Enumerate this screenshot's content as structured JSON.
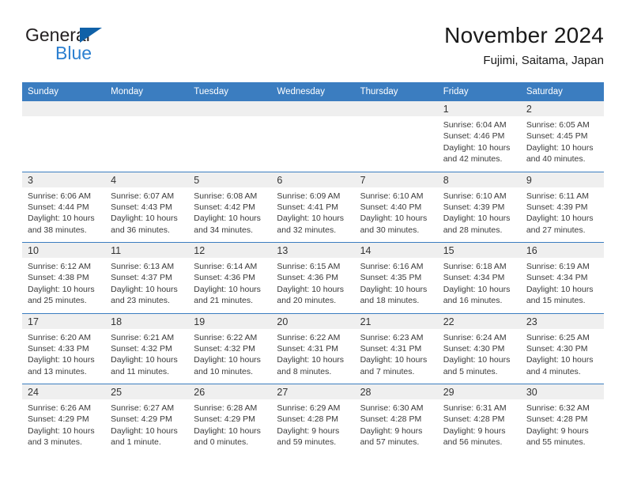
{
  "brand": {
    "word1": "General",
    "word2": "Blue",
    "triangle_color": "#1061a8",
    "word2_color": "#2b7fd0"
  },
  "header": {
    "title": "November 2024",
    "subtitle": "Fujimi, Saitama, Japan"
  },
  "theme": {
    "header_blue": "#3b7dc0",
    "daynum_band": "#efefef",
    "page_bg": "#ffffff"
  },
  "weekdays": [
    "Sunday",
    "Monday",
    "Tuesday",
    "Wednesday",
    "Thursday",
    "Friday",
    "Saturday"
  ],
  "weeks": [
    [
      {
        "day": "",
        "empty": true,
        "sunrise": "",
        "sunset": "",
        "daylight1": "",
        "daylight2": ""
      },
      {
        "day": "",
        "empty": true,
        "sunrise": "",
        "sunset": "",
        "daylight1": "",
        "daylight2": ""
      },
      {
        "day": "",
        "empty": true,
        "sunrise": "",
        "sunset": "",
        "daylight1": "",
        "daylight2": ""
      },
      {
        "day": "",
        "empty": true,
        "sunrise": "",
        "sunset": "",
        "daylight1": "",
        "daylight2": ""
      },
      {
        "day": "",
        "empty": true,
        "sunrise": "",
        "sunset": "",
        "daylight1": "",
        "daylight2": ""
      },
      {
        "day": "1",
        "empty": false,
        "sunrise": "Sunrise: 6:04 AM",
        "sunset": "Sunset: 4:46 PM",
        "daylight1": "Daylight: 10 hours",
        "daylight2": "and 42 minutes."
      },
      {
        "day": "2",
        "empty": false,
        "sunrise": "Sunrise: 6:05 AM",
        "sunset": "Sunset: 4:45 PM",
        "daylight1": "Daylight: 10 hours",
        "daylight2": "and 40 minutes."
      }
    ],
    [
      {
        "day": "3",
        "empty": false,
        "sunrise": "Sunrise: 6:06 AM",
        "sunset": "Sunset: 4:44 PM",
        "daylight1": "Daylight: 10 hours",
        "daylight2": "and 38 minutes."
      },
      {
        "day": "4",
        "empty": false,
        "sunrise": "Sunrise: 6:07 AM",
        "sunset": "Sunset: 4:43 PM",
        "daylight1": "Daylight: 10 hours",
        "daylight2": "and 36 minutes."
      },
      {
        "day": "5",
        "empty": false,
        "sunrise": "Sunrise: 6:08 AM",
        "sunset": "Sunset: 4:42 PM",
        "daylight1": "Daylight: 10 hours",
        "daylight2": "and 34 minutes."
      },
      {
        "day": "6",
        "empty": false,
        "sunrise": "Sunrise: 6:09 AM",
        "sunset": "Sunset: 4:41 PM",
        "daylight1": "Daylight: 10 hours",
        "daylight2": "and 32 minutes."
      },
      {
        "day": "7",
        "empty": false,
        "sunrise": "Sunrise: 6:10 AM",
        "sunset": "Sunset: 4:40 PM",
        "daylight1": "Daylight: 10 hours",
        "daylight2": "and 30 minutes."
      },
      {
        "day": "8",
        "empty": false,
        "sunrise": "Sunrise: 6:10 AM",
        "sunset": "Sunset: 4:39 PM",
        "daylight1": "Daylight: 10 hours",
        "daylight2": "and 28 minutes."
      },
      {
        "day": "9",
        "empty": false,
        "sunrise": "Sunrise: 6:11 AM",
        "sunset": "Sunset: 4:39 PM",
        "daylight1": "Daylight: 10 hours",
        "daylight2": "and 27 minutes."
      }
    ],
    [
      {
        "day": "10",
        "empty": false,
        "sunrise": "Sunrise: 6:12 AM",
        "sunset": "Sunset: 4:38 PM",
        "daylight1": "Daylight: 10 hours",
        "daylight2": "and 25 minutes."
      },
      {
        "day": "11",
        "empty": false,
        "sunrise": "Sunrise: 6:13 AM",
        "sunset": "Sunset: 4:37 PM",
        "daylight1": "Daylight: 10 hours",
        "daylight2": "and 23 minutes."
      },
      {
        "day": "12",
        "empty": false,
        "sunrise": "Sunrise: 6:14 AM",
        "sunset": "Sunset: 4:36 PM",
        "daylight1": "Daylight: 10 hours",
        "daylight2": "and 21 minutes."
      },
      {
        "day": "13",
        "empty": false,
        "sunrise": "Sunrise: 6:15 AM",
        "sunset": "Sunset: 4:36 PM",
        "daylight1": "Daylight: 10 hours",
        "daylight2": "and 20 minutes."
      },
      {
        "day": "14",
        "empty": false,
        "sunrise": "Sunrise: 6:16 AM",
        "sunset": "Sunset: 4:35 PM",
        "daylight1": "Daylight: 10 hours",
        "daylight2": "and 18 minutes."
      },
      {
        "day": "15",
        "empty": false,
        "sunrise": "Sunrise: 6:18 AM",
        "sunset": "Sunset: 4:34 PM",
        "daylight1": "Daylight: 10 hours",
        "daylight2": "and 16 minutes."
      },
      {
        "day": "16",
        "empty": false,
        "sunrise": "Sunrise: 6:19 AM",
        "sunset": "Sunset: 4:34 PM",
        "daylight1": "Daylight: 10 hours",
        "daylight2": "and 15 minutes."
      }
    ],
    [
      {
        "day": "17",
        "empty": false,
        "sunrise": "Sunrise: 6:20 AM",
        "sunset": "Sunset: 4:33 PM",
        "daylight1": "Daylight: 10 hours",
        "daylight2": "and 13 minutes."
      },
      {
        "day": "18",
        "empty": false,
        "sunrise": "Sunrise: 6:21 AM",
        "sunset": "Sunset: 4:32 PM",
        "daylight1": "Daylight: 10 hours",
        "daylight2": "and 11 minutes."
      },
      {
        "day": "19",
        "empty": false,
        "sunrise": "Sunrise: 6:22 AM",
        "sunset": "Sunset: 4:32 PM",
        "daylight1": "Daylight: 10 hours",
        "daylight2": "and 10 minutes."
      },
      {
        "day": "20",
        "empty": false,
        "sunrise": "Sunrise: 6:22 AM",
        "sunset": "Sunset: 4:31 PM",
        "daylight1": "Daylight: 10 hours",
        "daylight2": "and 8 minutes."
      },
      {
        "day": "21",
        "empty": false,
        "sunrise": "Sunrise: 6:23 AM",
        "sunset": "Sunset: 4:31 PM",
        "daylight1": "Daylight: 10 hours",
        "daylight2": "and 7 minutes."
      },
      {
        "day": "22",
        "empty": false,
        "sunrise": "Sunrise: 6:24 AM",
        "sunset": "Sunset: 4:30 PM",
        "daylight1": "Daylight: 10 hours",
        "daylight2": "and 5 minutes."
      },
      {
        "day": "23",
        "empty": false,
        "sunrise": "Sunrise: 6:25 AM",
        "sunset": "Sunset: 4:30 PM",
        "daylight1": "Daylight: 10 hours",
        "daylight2": "and 4 minutes."
      }
    ],
    [
      {
        "day": "24",
        "empty": false,
        "sunrise": "Sunrise: 6:26 AM",
        "sunset": "Sunset: 4:29 PM",
        "daylight1": "Daylight: 10 hours",
        "daylight2": "and 3 minutes."
      },
      {
        "day": "25",
        "empty": false,
        "sunrise": "Sunrise: 6:27 AM",
        "sunset": "Sunset: 4:29 PM",
        "daylight1": "Daylight: 10 hours",
        "daylight2": "and 1 minute."
      },
      {
        "day": "26",
        "empty": false,
        "sunrise": "Sunrise: 6:28 AM",
        "sunset": "Sunset: 4:29 PM",
        "daylight1": "Daylight: 10 hours",
        "daylight2": "and 0 minutes."
      },
      {
        "day": "27",
        "empty": false,
        "sunrise": "Sunrise: 6:29 AM",
        "sunset": "Sunset: 4:28 PM",
        "daylight1": "Daylight: 9 hours",
        "daylight2": "and 59 minutes."
      },
      {
        "day": "28",
        "empty": false,
        "sunrise": "Sunrise: 6:30 AM",
        "sunset": "Sunset: 4:28 PM",
        "daylight1": "Daylight: 9 hours",
        "daylight2": "and 57 minutes."
      },
      {
        "day": "29",
        "empty": false,
        "sunrise": "Sunrise: 6:31 AM",
        "sunset": "Sunset: 4:28 PM",
        "daylight1": "Daylight: 9 hours",
        "daylight2": "and 56 minutes."
      },
      {
        "day": "30",
        "empty": false,
        "sunrise": "Sunrise: 6:32 AM",
        "sunset": "Sunset: 4:28 PM",
        "daylight1": "Daylight: 9 hours",
        "daylight2": "and 55 minutes."
      }
    ]
  ]
}
